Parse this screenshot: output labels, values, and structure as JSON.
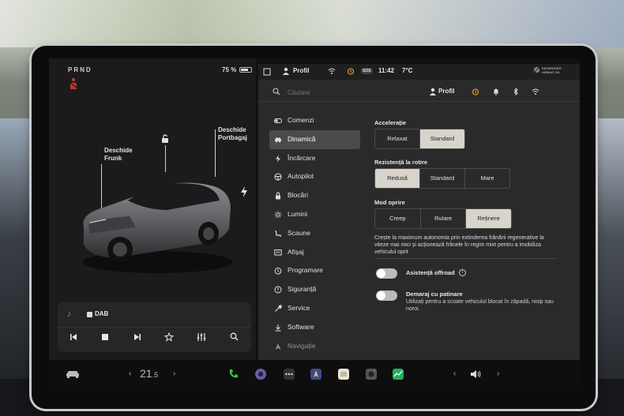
{
  "vehicle": {
    "gear_indicator": "PRND",
    "battery_percent": "75 %",
    "battery_level": 0.75,
    "frunk_label_line1": "Deschide",
    "frunk_label_line2": "Frunk",
    "trunk_label_line1": "Deschide",
    "trunk_label_line2": "Portbagaj",
    "paint_color": "#6b6d70"
  },
  "media": {
    "source_label": "DAB",
    "controls": [
      "prev",
      "stop",
      "next",
      "favorite",
      "equalizer",
      "search"
    ]
  },
  "status_bar": {
    "profile_label": "Profil",
    "time": "11:42",
    "temperature": "7°C",
    "sos_badge": "SOS",
    "passenger_airbag_line1": "PASSENGER",
    "passenger_airbag_line2": "AIRBAG ON"
  },
  "search": {
    "placeholder": "Căutare",
    "profile_label": "Profil"
  },
  "menu": {
    "items": [
      {
        "label": "Comenzi",
        "icon": "toggle-icon"
      },
      {
        "label": "Dinamică",
        "icon": "car-icon",
        "active": true
      },
      {
        "label": "Încărcare",
        "icon": "bolt-icon"
      },
      {
        "label": "Autopilot",
        "icon": "steering-wheel-icon"
      },
      {
        "label": "Blocări",
        "icon": "lock-icon"
      },
      {
        "label": "Lumini",
        "icon": "sun-icon"
      },
      {
        "label": "Scaune",
        "icon": "seat-icon"
      },
      {
        "label": "Afișaj",
        "icon": "display-icon"
      },
      {
        "label": "Programare",
        "icon": "clock-icon"
      },
      {
        "label": "Siguranță",
        "icon": "shield-icon"
      },
      {
        "label": "Service",
        "icon": "wrench-icon"
      },
      {
        "label": "Software",
        "icon": "download-icon"
      },
      {
        "label": "Navigație",
        "icon": "navigation-icon"
      }
    ]
  },
  "dynamics": {
    "acceleration": {
      "title": "Accelerație",
      "options": [
        "Relaxat",
        "Standard"
      ],
      "selected": "Standard"
    },
    "steering": {
      "title": "Rezistență la rotire",
      "options": [
        "Redusă",
        "Standard",
        "Mare"
      ],
      "selected": "Redusă"
    },
    "stop_mode": {
      "title": "Mod oprire",
      "options": [
        "Creep",
        "Rulare",
        "Reținere"
      ],
      "selected": "Reținere",
      "description": "Crește la maximum autonomia prin extinderea frânării regenerative la viteze mai mici și acționează frânele în regim mixt pentru a imobiliza vehiculul oprit"
    },
    "offroad_assist": {
      "label": "Asistență offroad",
      "enabled": false
    },
    "slip_start": {
      "label": "Demaraj cu patinare",
      "description": "Utilizați pentru a scoate vehiculul blocat în zăpadă, nisip sau noroi.",
      "enabled": false
    }
  },
  "dock": {
    "cabin_temp_whole": "21",
    "cabin_temp_decimal": ".5",
    "icons": [
      "car-icon",
      "phone-icon",
      "camera-icon",
      "more-icon",
      "tesla-app-icon",
      "toybox-icon",
      "dashcam-icon",
      "energy-icon",
      "volume-icon"
    ]
  },
  "colors": {
    "accent_selected": "#d8d4cc",
    "alert_red": "#c0392b",
    "phone_green": "#2ecc40"
  }
}
